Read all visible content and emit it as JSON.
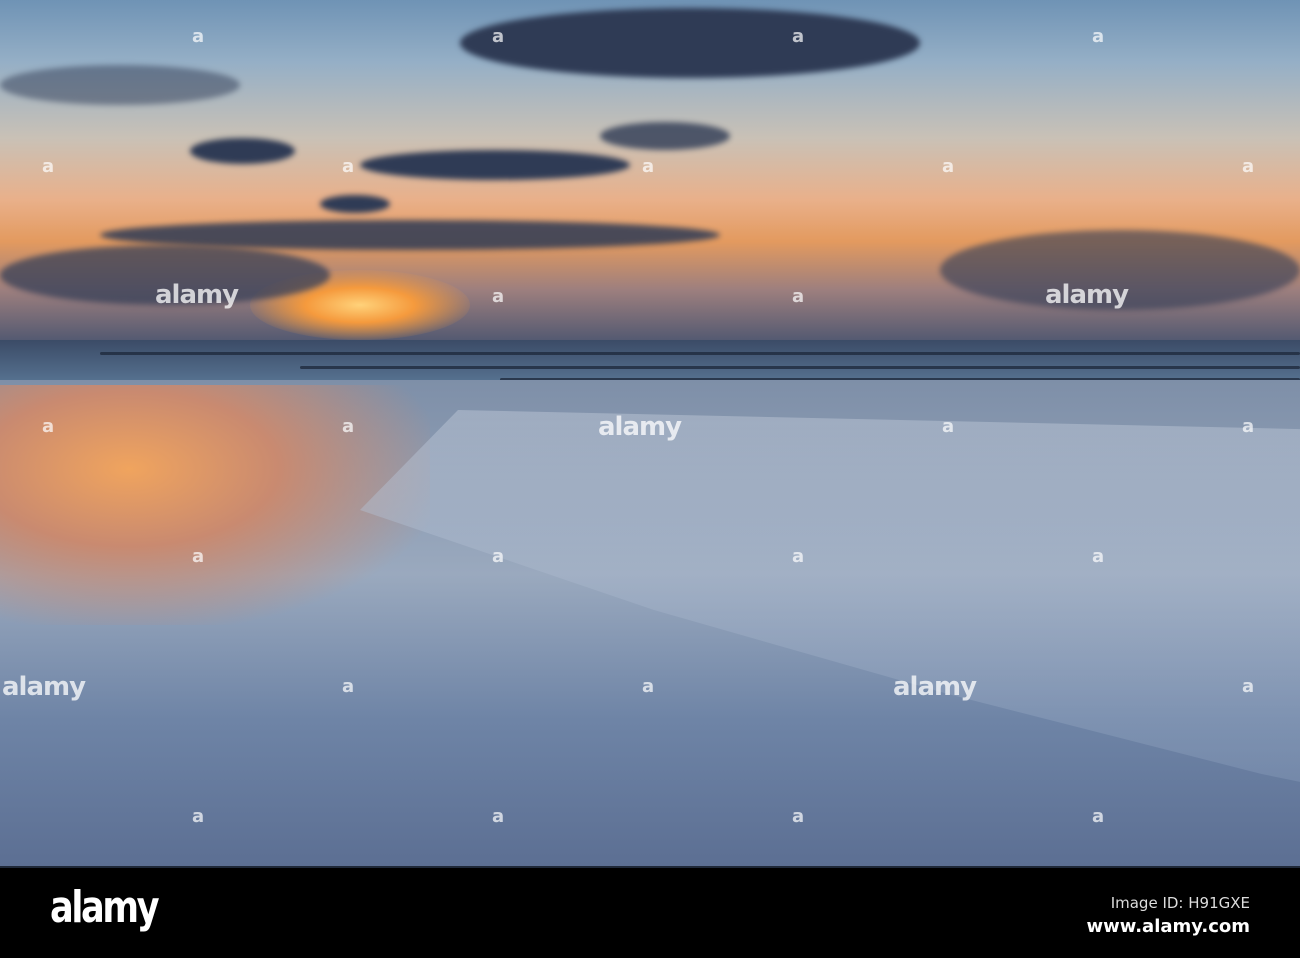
{
  "watermark": {
    "brand": "alamy",
    "mark": "a"
  },
  "footer": {
    "logo": "alamy",
    "image_id": "Image ID: H91GXE",
    "url": "www.alamy.com"
  }
}
